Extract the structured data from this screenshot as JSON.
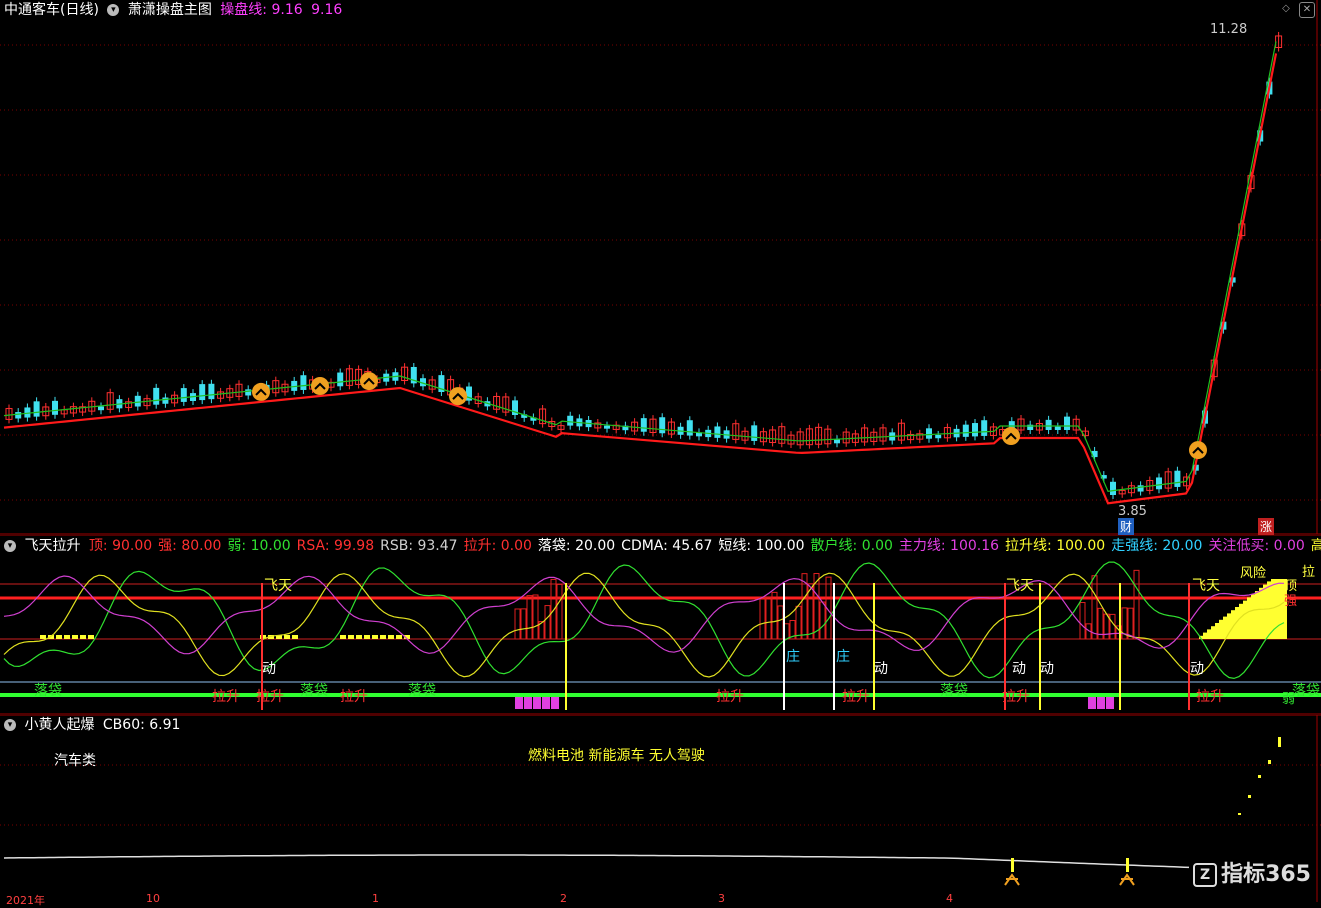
{
  "main": {
    "stock_name": "中通客车(日线)",
    "indicator_name": "萧潇操盘主图",
    "line_label": "操盘线: 9.16",
    "line_value2": "9.16",
    "high_price": "11.28",
    "low_price": "3.85",
    "badge_cai": "财",
    "badge_zhang": "涨"
  },
  "sub1": {
    "name": "飞天拉升",
    "items": [
      {
        "text": "顶: 90.00",
        "color": "#ff3030"
      },
      {
        "text": "强: 80.00",
        "color": "#ff3030"
      },
      {
        "text": "弱: 10.00",
        "color": "#30e030"
      },
      {
        "text": "RSA: 99.98",
        "color": "#ff3030"
      },
      {
        "text": "RSB: 93.47",
        "color": "#d0d0d0"
      },
      {
        "text": "拉升: 0.00",
        "color": "#ff3030"
      },
      {
        "text": "落袋: 20.00",
        "color": "#ffffff"
      },
      {
        "text": "CDMA: 45.67",
        "color": "#ffffff"
      },
      {
        "text": "短线: 100.00",
        "color": "#ffffff"
      },
      {
        "text": "散户线: 0.00",
        "color": "#30e030"
      },
      {
        "text": "主力线: 100.16",
        "color": "#e040e0"
      },
      {
        "text": "拉升线: 100.00",
        "color": "#ffff30"
      },
      {
        "text": "走强线: 20.00",
        "color": "#30d0ff"
      },
      {
        "text": "关注低买: 0.00",
        "color": "#e040e0"
      },
      {
        "text": "高",
        "color": "#ffff30"
      }
    ],
    "labels": {
      "feitian1": "飞天",
      "feitian2": "飞天",
      "feitian3": "飞天",
      "dong": "动",
      "zhuang": "庄",
      "luodai": "落袋",
      "lasheng": "拉升",
      "fengxian": "风险",
      "ding": "顶",
      "qiang": "强",
      "la": "拉",
      "ruo": "弱"
    }
  },
  "sub2": {
    "name": "小黄人起爆",
    "cb60": "CB60: 6.91",
    "category": "汽车类",
    "concepts": "燃料电池 新能源车 无人驾驶"
  },
  "axis": {
    "ticks": [
      "2021年",
      "10",
      "1",
      "2",
      "3",
      "4"
    ]
  },
  "watermark": "指标365",
  "colors": {
    "up": "#ff3030",
    "down": "#40e0f0",
    "red_line": "#ff1a1a",
    "green_line": "#20c020",
    "grid": "#8b0000",
    "yellow": "#ffff30",
    "magenta": "#e040e0"
  }
}
